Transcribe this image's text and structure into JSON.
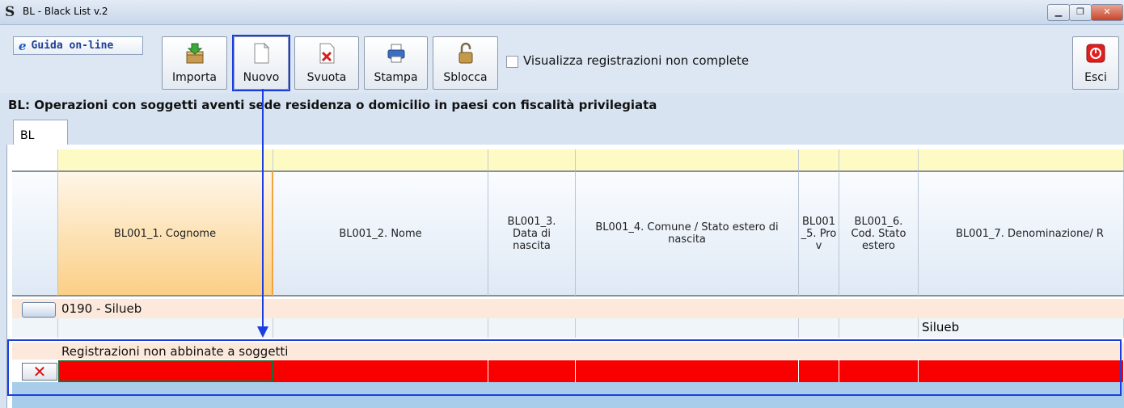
{
  "window": {
    "icon": "S",
    "title": "BL - Black List v.2",
    "controls": [
      "minimize",
      "restore",
      "close"
    ]
  },
  "toolbar": {
    "guida_label": "Guida on-line",
    "buttons": [
      {
        "id": "importa",
        "label": "Importa",
        "icon": "download-box-icon"
      },
      {
        "id": "nuovo",
        "label": "Nuovo",
        "icon": "new-document-icon"
      },
      {
        "id": "svuota",
        "label": "Svuota",
        "icon": "clear-document-icon"
      },
      {
        "id": "stampa",
        "label": "Stampa",
        "icon": "printer-icon"
      },
      {
        "id": "sblocca",
        "label": "Sblocca",
        "icon": "padlock-icon"
      }
    ],
    "checkbox_label": "Visualizza registrazioni non complete",
    "checkbox_checked": false,
    "esci_label": "Esci"
  },
  "heading": "BL: Operazioni con soggetti aventi sede residenza o domicilio in paesi con fiscalità privilegiata",
  "tab": "BL",
  "grid": {
    "columns": [
      "BL001_1. Cognome",
      "BL001_2. Nome",
      "BL001_3. Data di nascita",
      "BL001_4. Comune / Stato estero di nascita",
      "BL001_5. Prov",
      "BL001_6. Cod. Stato estero",
      "BL001_7. Denominazione/ R"
    ],
    "group_label": "0190 - Silueb",
    "group_row_value": "Silueb",
    "unmatched_label": "Registrazioni non abbinate a soggetti",
    "delete_symbol": "✕"
  },
  "colors": {
    "highlight": "#1c3ee0",
    "error_row": "#f90000",
    "selected_header": "#fbcf86"
  }
}
